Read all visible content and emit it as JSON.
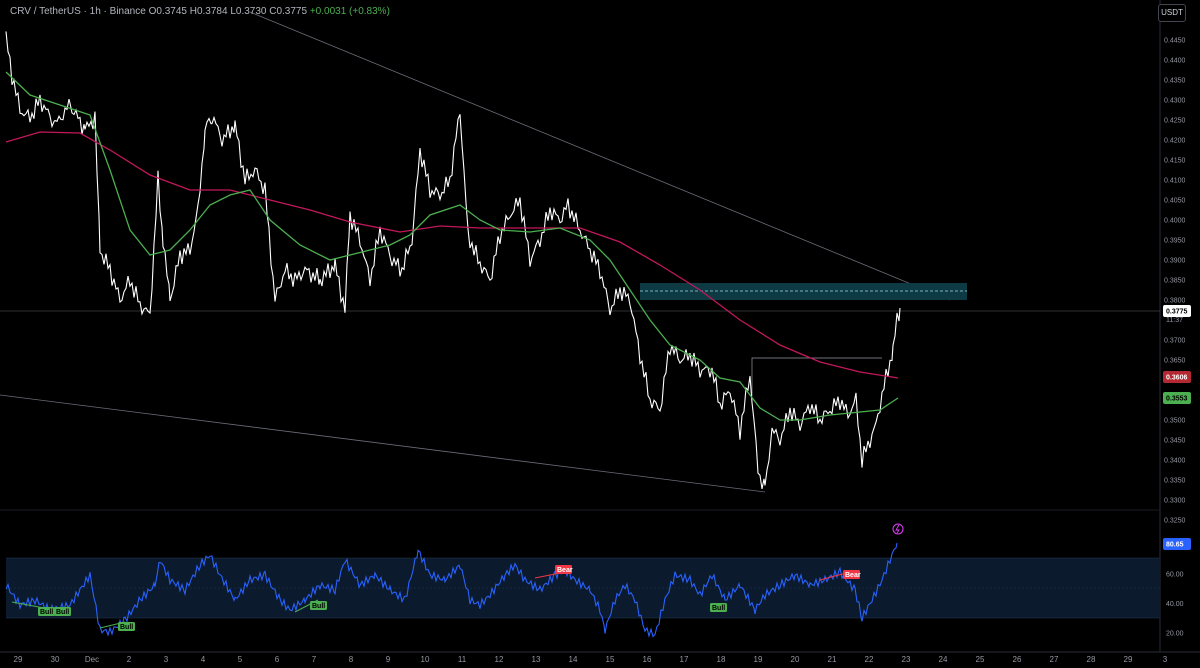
{
  "header": {
    "symbol": "CRV / TetherUS · 1h · Binance",
    "ohlc": "O0.3745 H0.3784 L0.3730 C0.3775",
    "change": "+0.0031 (+0.83%)"
  },
  "currency_button": "USDT",
  "price_axis": {
    "ticks": [
      "0.4450",
      "0.4400",
      "0.4350",
      "0.4300",
      "0.4250",
      "0.4200",
      "0.4150",
      "0.4100",
      "0.4050",
      "0.4000",
      "0.3950",
      "0.3900",
      "0.3850",
      "0.3800",
      "0.3700",
      "0.3650",
      "0.3550",
      "0.3500",
      "0.3450",
      "0.3400",
      "0.3350",
      "0.3300",
      "0.3250"
    ],
    "tick_values": [
      0.445,
      0.44,
      0.435,
      0.43,
      0.425,
      0.42,
      0.415,
      0.41,
      0.405,
      0.4,
      0.395,
      0.39,
      0.385,
      0.38,
      0.37,
      0.365,
      0.355,
      0.35,
      0.345,
      0.34,
      0.335,
      0.33,
      0.325
    ],
    "current_price": "0.3775",
    "countdown": "11:37",
    "ma_slow_value": "0.3606",
    "ma_fast_value": "0.3553"
  },
  "rsi_axis": {
    "ticks": [
      "60.00",
      "40.00",
      "20.00"
    ],
    "current": "80.65"
  },
  "date_axis": {
    "labels": [
      "29",
      "30",
      "Dec",
      "2",
      "3",
      "4",
      "5",
      "6",
      "7",
      "8",
      "9",
      "10",
      "11",
      "12",
      "13",
      "14",
      "15",
      "16",
      "17",
      "18",
      "19",
      "20",
      "21",
      "22",
      "23",
      "24",
      "25",
      "26",
      "27",
      "28",
      "29",
      "3"
    ]
  },
  "divergence_labels": [
    {
      "text": "Bull",
      "type": "bull"
    },
    {
      "text": "Bull",
      "type": "bull"
    },
    {
      "text": "Bull",
      "type": "bull"
    },
    {
      "text": "Bull",
      "type": "bull"
    },
    {
      "text": "Bull",
      "type": "bull"
    },
    {
      "text": "Bear",
      "type": "bear"
    },
    {
      "text": "Bear",
      "type": "bear"
    }
  ],
  "colors": {
    "price_line": "#ffffff",
    "ma_fast": "#4caf50",
    "ma_slow": "#c2185b",
    "rsi": "#2962ff",
    "bull": "#4caf50",
    "bear": "#f23645",
    "zone": "#0e3a44",
    "current_price_badge": "#ffffff",
    "ma_slow_badge": "#b22833",
    "ma_fast_badge": "#4caf50",
    "rsi_badge": "#2962ff"
  },
  "icons": {
    "alert": "lightning-alert-icon"
  }
}
